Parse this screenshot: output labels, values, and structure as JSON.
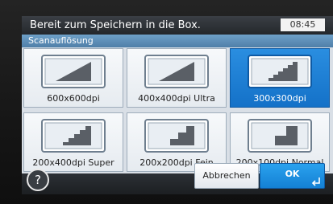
{
  "status_bar": {
    "message": "Bereit zum Speichern in die Box.",
    "time": "08:45"
  },
  "section": {
    "title": "Scanauflösung"
  },
  "resolution_options": [
    {
      "label": "600x600dpi",
      "icon": "resolution-600-icon",
      "selected": false
    },
    {
      "label": "400x400dpi Ultra",
      "icon": "resolution-400-icon",
      "selected": false
    },
    {
      "label": "300x300dpi",
      "icon": "resolution-300-icon",
      "selected": true
    },
    {
      "label": "200x400dpi Super",
      "icon": "resolution-200x400-icon",
      "selected": false
    },
    {
      "label": "200x200dpi Fein",
      "icon": "resolution-200-icon",
      "selected": false
    },
    {
      "label": "200x100dpi Normal",
      "icon": "resolution-200x100-icon",
      "selected": false
    }
  ],
  "actions": {
    "help_label": "?",
    "cancel_label": "Abbrechen",
    "ok_label": "OK"
  },
  "colors": {
    "selected_tile": "#1a7fd6",
    "status_bar": "#2e3237",
    "section_header": "#5f8fb8"
  }
}
